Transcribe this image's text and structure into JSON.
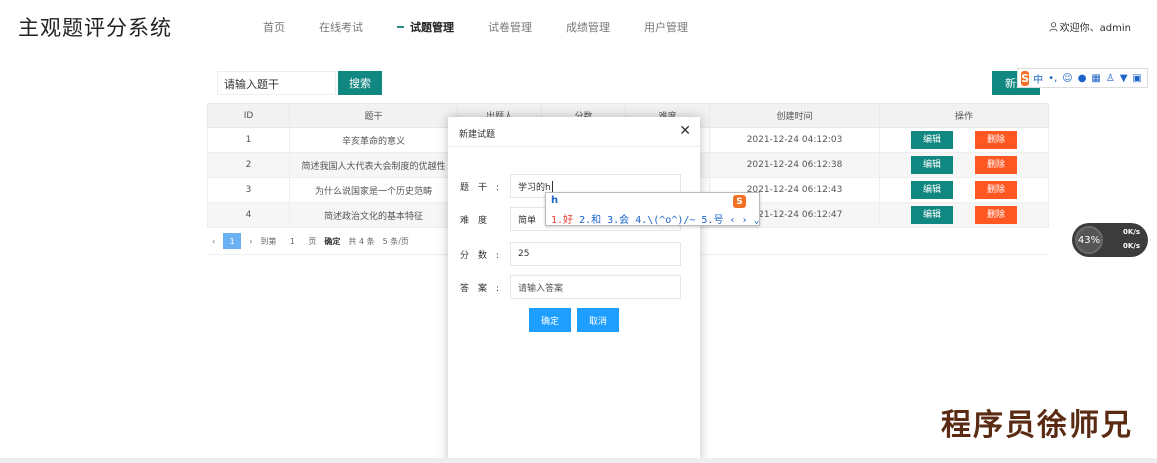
{
  "header": {
    "title": "主观题评分系统",
    "nav": [
      "首页",
      "在线考试",
      "试题管理",
      "试卷管理",
      "成绩管理",
      "用户管理"
    ],
    "active_index": 2,
    "user_text": "欢迎你、admin"
  },
  "toolbar": {
    "search_placeholder": "请输入题干",
    "search_label": "搜索",
    "new_label": "新建"
  },
  "ime_bar": {
    "logo": "S",
    "mode": "中",
    "punct": "•,",
    "icons": [
      "smiley-icon",
      "mic-icon",
      "keyboard-icon",
      "user-icon",
      "shirt-icon",
      "grid-icon"
    ]
  },
  "table": {
    "columns": [
      "ID",
      "题干",
      "出题人",
      "分数",
      "难度",
      "创建时间",
      "操作"
    ],
    "rows": [
      {
        "id": "1",
        "stem": "辛亥革命的意义",
        "created": "2021-12-24 04:12:03"
      },
      {
        "id": "2",
        "stem": "简述我国人大代表大会制度的优越性",
        "created": "2021-12-24 06:12:38"
      },
      {
        "id": "3",
        "stem": "为什么说国家是一个历史范畴",
        "created": "2021-12-24 06:12:43"
      },
      {
        "id": "4",
        "stem": "简述政治文化的基本特征",
        "created": "2021-12-24 06:12:47"
      }
    ],
    "edit_label": "编辑",
    "delete_label": "删除"
  },
  "pager": {
    "current": "1",
    "goto_label": "到第",
    "page_input": "1",
    "page_unit": "页",
    "confirm_label": "确定",
    "total": "共 4 条",
    "page_size": "5 条/页"
  },
  "modal": {
    "title": "新建试题",
    "fields": {
      "stem": {
        "label": "题干:",
        "value": "学习的h"
      },
      "difficulty": {
        "label": "难度",
        "value": "简单"
      },
      "score": {
        "label": "分数:",
        "value": "25"
      },
      "answer": {
        "label": "答案:",
        "placeholder": "请输入答案"
      }
    },
    "confirm_label": "确定",
    "cancel_label": "取消"
  },
  "ime_candidates": {
    "input": "h",
    "candidates": "1.好  2.和  3.会  4.\\(^o^)/~  5.号",
    "first": "1.好",
    "nav": "‹ › ⌄",
    "logo": "S"
  },
  "net_widget": {
    "percent": "43%",
    "upload": "0K/s",
    "download": "0K/s"
  },
  "watermark": "程序员徐师兄"
}
